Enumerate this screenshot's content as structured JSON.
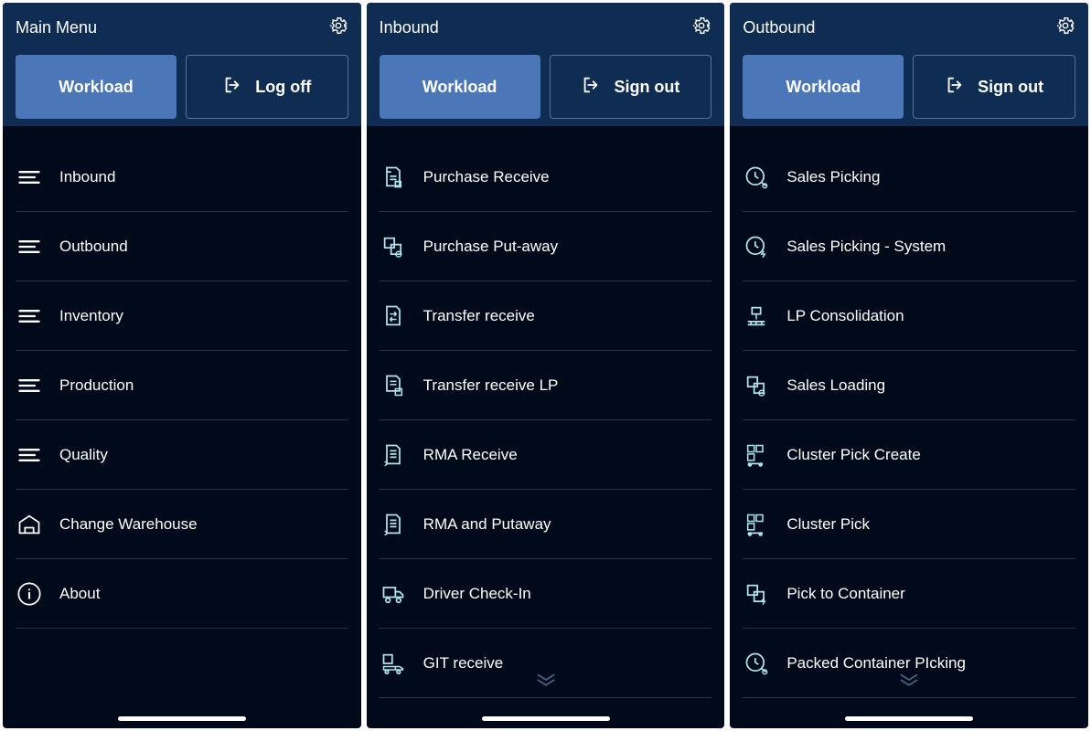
{
  "panels": [
    {
      "title": "Main Menu",
      "primary_btn": "Workload",
      "secondary_btn": "Log off",
      "items": [
        {
          "label": "Inbound",
          "icon": "hamburger"
        },
        {
          "label": "Outbound",
          "icon": "hamburger"
        },
        {
          "label": "Inventory",
          "icon": "hamburger"
        },
        {
          "label": "Production",
          "icon": "hamburger"
        },
        {
          "label": "Quality",
          "icon": "hamburger"
        },
        {
          "label": "Change Warehouse",
          "icon": "warehouse"
        },
        {
          "label": "About",
          "icon": "info"
        }
      ],
      "show_chevron": false
    },
    {
      "title": "Inbound",
      "primary_btn": "Workload",
      "secondary_btn": "Sign out",
      "items": [
        {
          "label": "Purchase Receive",
          "icon": "doc-receive"
        },
        {
          "label": "Purchase Put-away",
          "icon": "boxes"
        },
        {
          "label": "Transfer receive",
          "icon": "doc-transfer"
        },
        {
          "label": "Transfer receive LP",
          "icon": "doc-lp"
        },
        {
          "label": "RMA Receive",
          "icon": "doc-arrow"
        },
        {
          "label": "RMA and Putaway",
          "icon": "doc-arrow"
        },
        {
          "label": "Driver Check-In",
          "icon": "truck"
        },
        {
          "label": "GIT receive",
          "icon": "truck-box"
        }
      ],
      "show_chevron": true
    },
    {
      "title": "Outbound",
      "primary_btn": "Workload",
      "secondary_btn": "Sign out",
      "items": [
        {
          "label": "Sales Picking",
          "icon": "clock-arrow"
        },
        {
          "label": "Sales Picking - System",
          "icon": "clock-bolt"
        },
        {
          "label": "LP Consolidation",
          "icon": "pallet"
        },
        {
          "label": "Sales Loading",
          "icon": "boxes"
        },
        {
          "label": "Cluster Pick Create",
          "icon": "grid-cart"
        },
        {
          "label": "Cluster Pick",
          "icon": "grid-cart"
        },
        {
          "label": "Pick to Container",
          "icon": "boxes-bolt"
        },
        {
          "label": "Packed Container PIcking",
          "icon": "clock-arrow"
        }
      ],
      "show_chevron": true
    }
  ]
}
